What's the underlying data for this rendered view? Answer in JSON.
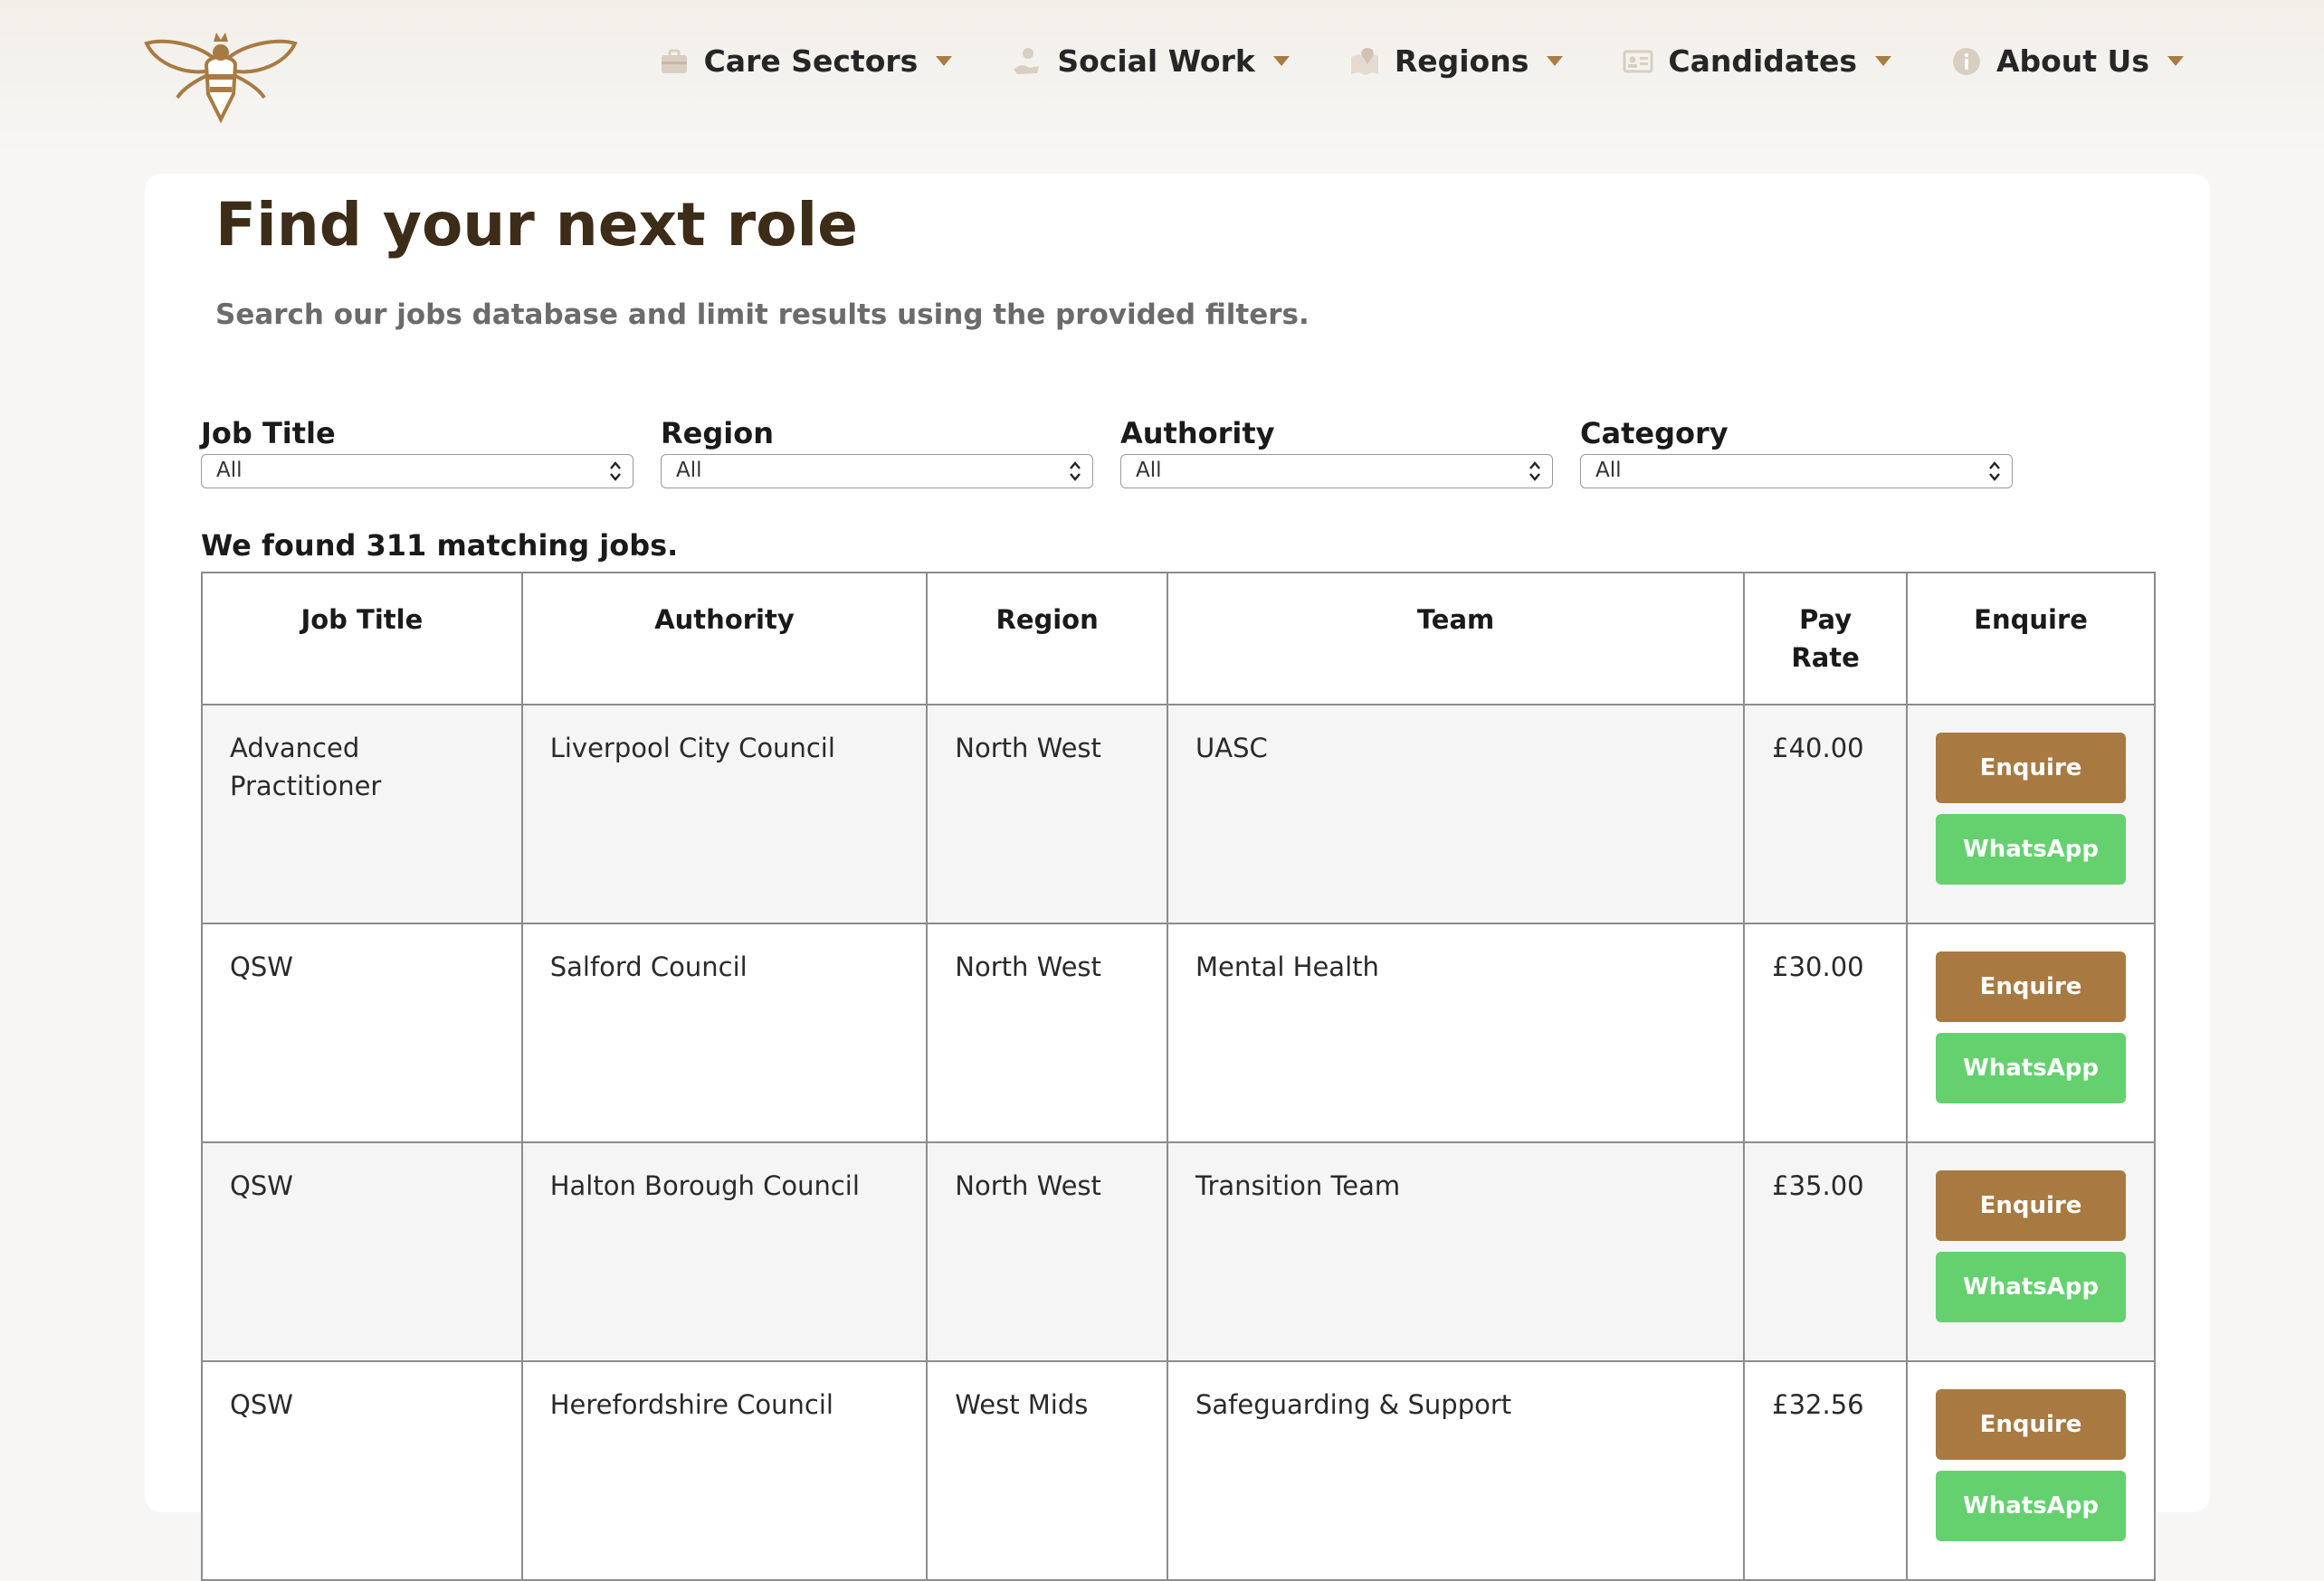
{
  "nav": {
    "items": [
      {
        "label": "Care Sectors",
        "icon": "briefcase-icon"
      },
      {
        "label": "Social Work",
        "icon": "caring-hand-icon"
      },
      {
        "label": "Regions",
        "icon": "map-pin-icon"
      },
      {
        "label": "Candidates",
        "icon": "id-card-icon"
      },
      {
        "label": "About Us",
        "icon": "info-icon"
      }
    ]
  },
  "page": {
    "title": "Find your next role",
    "subtitle": "Search our jobs database and limit results using the provided filters."
  },
  "filters": [
    {
      "label": "Job Title",
      "value": "All"
    },
    {
      "label": "Region",
      "value": "All"
    },
    {
      "label": "Authority",
      "value": "All"
    },
    {
      "label": "Category",
      "value": "All"
    }
  ],
  "results": {
    "count_text": "We found 311 matching jobs."
  },
  "table": {
    "headers": {
      "job_title": "Job Title",
      "authority": "Authority",
      "region": "Region",
      "team": "Team",
      "pay_line1": "Pay",
      "pay_line2": "Rate",
      "enquire": "Enquire"
    },
    "rows": [
      {
        "job_title": "Advanced Practitioner",
        "authority": "Liverpool City Council",
        "region": "North West",
        "team": "UASC",
        "pay_rate": "£40.00"
      },
      {
        "job_title": "QSW",
        "authority": "Salford Council",
        "region": "North West",
        "team": "Mental Health",
        "pay_rate": "£30.00"
      },
      {
        "job_title": "QSW",
        "authority": "Halton Borough Council",
        "region": "North West",
        "team": "Transition Team",
        "pay_rate": "£35.00"
      },
      {
        "job_title": "QSW",
        "authority": "Herefordshire Council",
        "region": "West Mids",
        "team": "Safeguarding & Support",
        "pay_rate": "£32.56"
      }
    ],
    "buttons": {
      "enquire": "Enquire",
      "whatsapp": "WhatsApp"
    }
  },
  "colors": {
    "brand_gold": "#a87a42",
    "whatsapp_green": "#64d16e",
    "title_brown": "#3c2c18"
  }
}
